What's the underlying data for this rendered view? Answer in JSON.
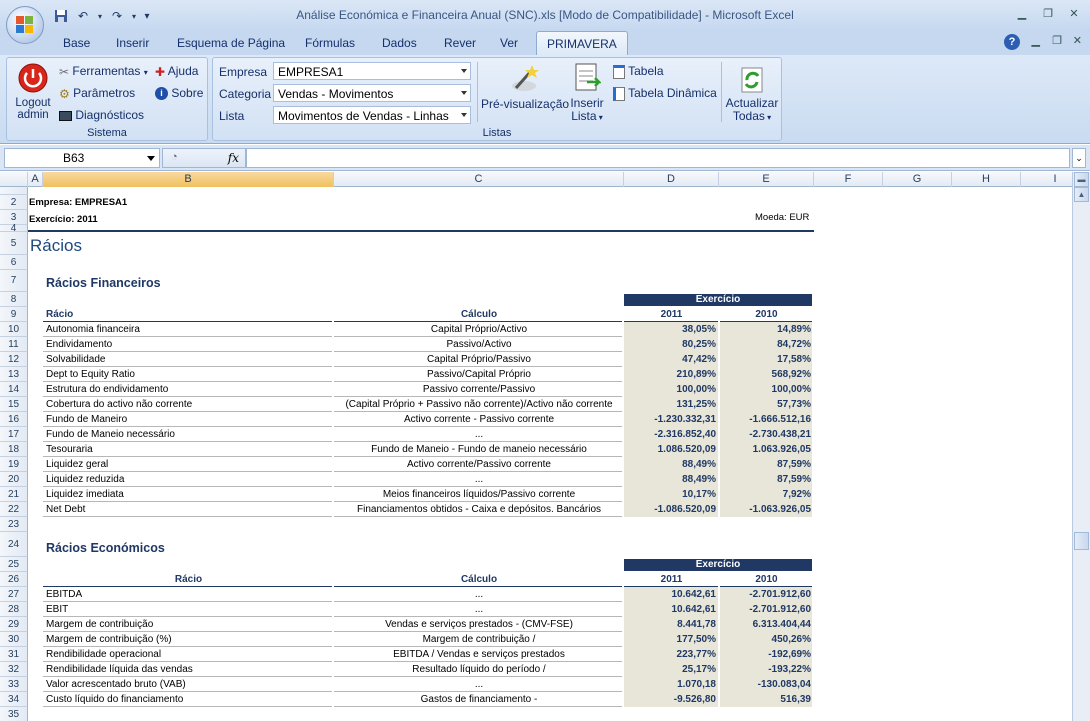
{
  "window": {
    "title": "Análise Económica e Financeira Anual (SNC).xls  [Modo de Compatibilidade] - Microsoft Excel"
  },
  "tabs": [
    "Base",
    "Inserir",
    "Esquema de Página",
    "Fórmulas",
    "Dados",
    "Rever",
    "Ver",
    "PRIMAVERA"
  ],
  "ribbon": {
    "sistema": {
      "logout": "Logout admin",
      "ferramentas": "Ferramentas",
      "parametros": "Parâmetros",
      "diagnosticos": "Diagnósticos",
      "ajuda": "Ajuda",
      "sobre": "Sobre",
      "group_label": "Sistema"
    },
    "listas": {
      "empresa_label": "Empresa",
      "empresa_value": "EMPRESA1",
      "categoria_label": "Categoria",
      "categoria_value": "Vendas - Movimentos",
      "lista_label": "Lista",
      "lista_value": "Movimentos de Vendas - Linhas",
      "pre_visualizacao": "Pré-visualização",
      "inserir_lista_1": "Inserir",
      "inserir_lista_2": "Lista",
      "tabela": "Tabela",
      "tabela_dinamica": "Tabela Dinâmica",
      "actualizar_1": "Actualizar",
      "actualizar_2": "Todas",
      "group_label": "Listas"
    }
  },
  "formula_bar": {
    "name_box": "B63",
    "fx": "fx",
    "formula": ""
  },
  "columns": [
    "A",
    "B",
    "C",
    "D",
    "E",
    "F",
    "G",
    "H",
    "I"
  ],
  "sheet": {
    "empresa": "Empresa: EMPRESA1",
    "exercicio": "Exercício: 2011",
    "moeda": "Moeda: EUR",
    "title": "Rácios",
    "financeiros": {
      "title": "Rácios Financeiros",
      "exercicio_header": "Exercício",
      "col_racio": "Rácio",
      "col_calculo": "Cálculo",
      "col_y1": "2011",
      "col_y2": "2010",
      "rows": [
        {
          "row": "10",
          "racio": "Autonomia financeira",
          "calculo": "Capital Próprio/Activo",
          "y1": "38,05%",
          "y2": "14,89%"
        },
        {
          "row": "11",
          "racio": "Endividamento",
          "calculo": "Passivo/Activo",
          "y1": "80,25%",
          "y2": "84,72%"
        },
        {
          "row": "12",
          "racio": "Solvabilidade",
          "calculo": "Capital Próprio/Passivo",
          "y1": "47,42%",
          "y2": "17,58%"
        },
        {
          "row": "13",
          "racio": "Dept to Equity Ratio",
          "calculo": "Passivo/Capital Próprio",
          "y1": "210,89%",
          "y2": "568,92%"
        },
        {
          "row": "14",
          "racio": "Estrutura do endividamento",
          "calculo": "Passivo corrente/Passivo",
          "y1": "100,00%",
          "y2": "100,00%"
        },
        {
          "row": "15",
          "racio": "Cobertura do activo não corrente",
          "calculo": "(Capital Próprio + Passivo não corrente)/Activo não corrente",
          "y1": "131,25%",
          "y2": "57,73%"
        },
        {
          "row": "16",
          "racio": "Fundo de Maneiro",
          "calculo": "Activo corrente - Passivo corrente",
          "y1": "-1.230.332,31",
          "y2": "-1.666.512,16"
        },
        {
          "row": "17",
          "racio": "Fundo de Maneio necessário",
          "calculo": "...",
          "y1": "-2.316.852,40",
          "y2": "-2.730.438,21"
        },
        {
          "row": "18",
          "racio": "Tesouraria",
          "calculo": "Fundo de Maneio - Fundo de maneio necessário",
          "y1": "1.086.520,09",
          "y2": "1.063.926,05"
        },
        {
          "row": "19",
          "racio": "Liquidez geral",
          "calculo": "Activo corrente/Passivo corrente",
          "y1": "88,49%",
          "y2": "87,59%"
        },
        {
          "row": "20",
          "racio": "Liquidez reduzida",
          "calculo": "...",
          "y1": "88,49%",
          "y2": "87,59%"
        },
        {
          "row": "21",
          "racio": "Liquidez imediata",
          "calculo": "Meios financeiros líquidos/Passivo corrente",
          "y1": "10,17%",
          "y2": "7,92%"
        },
        {
          "row": "22",
          "racio": "Net Debt",
          "calculo": "Financiamentos obtidos - Caixa e depósitos. Bancários",
          "y1": "-1.086.520,09",
          "y2": "-1.063.926,05"
        }
      ]
    },
    "economicos": {
      "title": "Rácios Económicos",
      "exercicio_header": "Exercício",
      "col_racio": "Rácio",
      "col_calculo": "Cálculo",
      "col_y1": "2011",
      "col_y2": "2010",
      "rows": [
        {
          "row": "27",
          "racio": "EBITDA",
          "calculo": "...",
          "y1": "10.642,61",
          "y2": "-2.701.912,60"
        },
        {
          "row": "28",
          "racio": "EBIT",
          "calculo": "...",
          "y1": "10.642,61",
          "y2": "-2.701.912,60"
        },
        {
          "row": "29",
          "racio": "Margem de contribuição",
          "calculo": "Vendas e serviços prestados - (CMV-FSE)",
          "y1": "8.441,78",
          "y2": "6.313.404,44"
        },
        {
          "row": "30",
          "racio": "Margem de contribuição (%)",
          "calculo": "Margem de contribuição /",
          "y1": "177,50%",
          "y2": "450,26%"
        },
        {
          "row": "31",
          "racio": "Rendibilidade operacional",
          "calculo": "EBITDA / Vendas e serviços prestados",
          "y1": "223,77%",
          "y2": "-192,69%"
        },
        {
          "row": "32",
          "racio": "Rendibilidade líquida das vendas",
          "calculo": "Resultado líquido do período /",
          "y1": "25,17%",
          "y2": "-193,22%"
        },
        {
          "row": "33",
          "racio": "Valor acrescentado bruto (VAB)",
          "calculo": "...",
          "y1": "1.070,18",
          "y2": "-130.083,04"
        },
        {
          "row": "34",
          "racio": "Custo líquido do financiamento",
          "calculo": "Gastos de financiamento -",
          "y1": "-9.526,80",
          "y2": "516,39"
        }
      ]
    }
  }
}
